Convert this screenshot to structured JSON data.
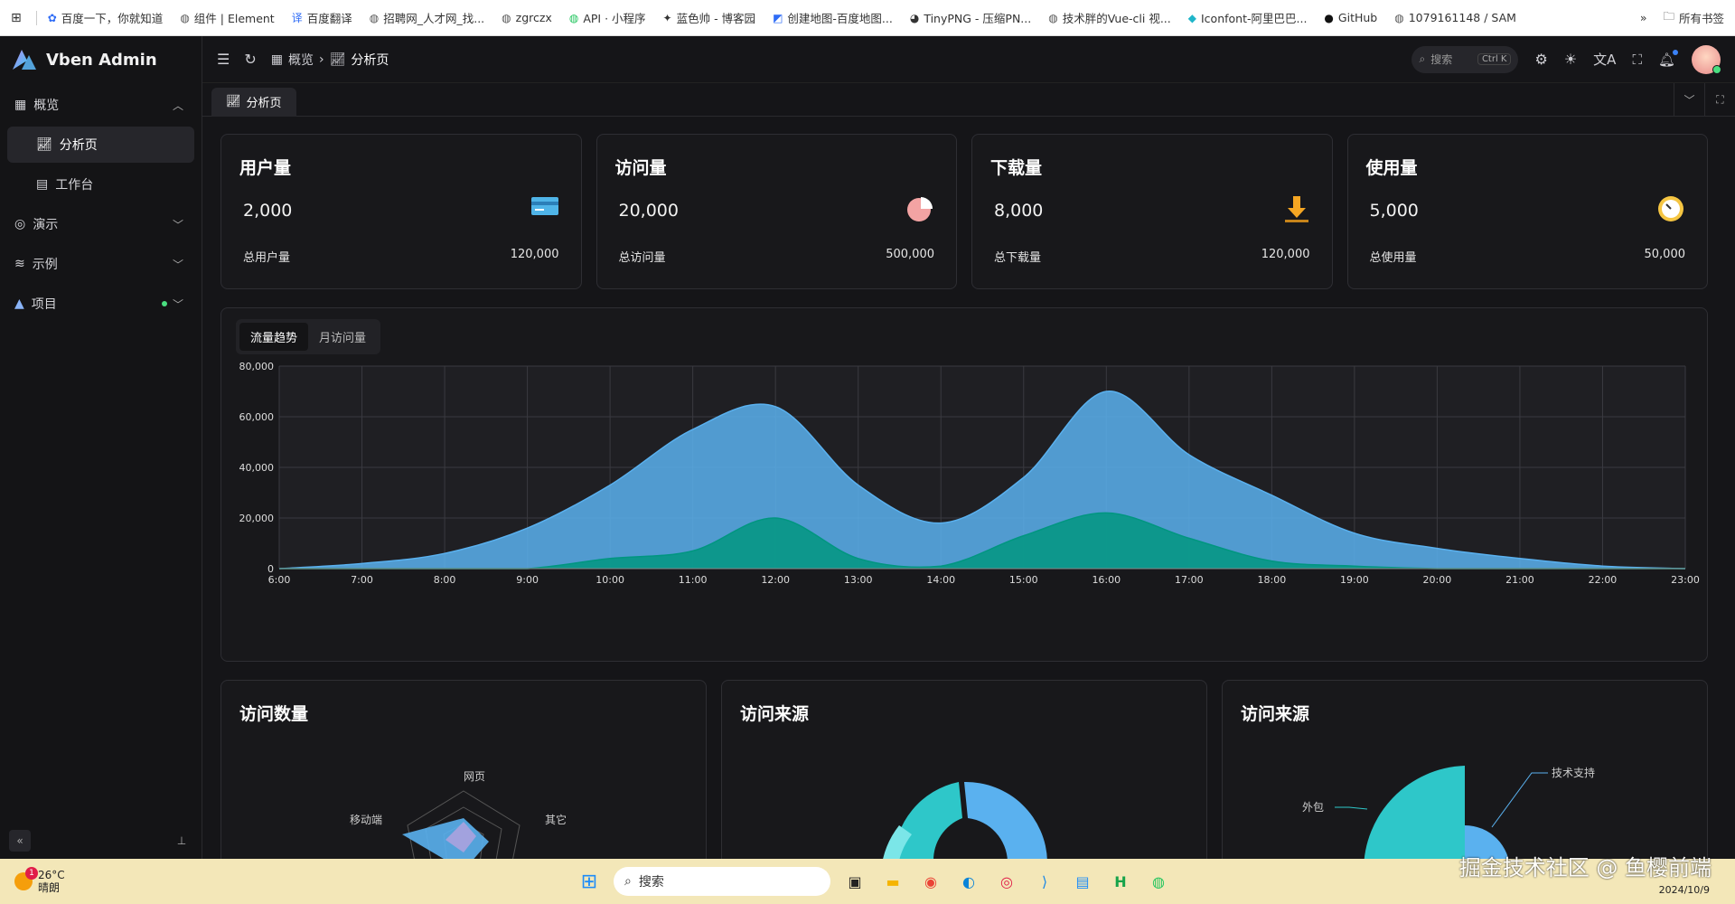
{
  "bookmarks": {
    "items": [
      {
        "label": "百度一下，你就知道",
        "icon": "paw-icon",
        "color": "#2f6cf6"
      },
      {
        "label": "组件 | Element",
        "icon": "globe-icon",
        "color": "#555"
      },
      {
        "label": "百度翻译",
        "icon": "translate-icon",
        "color": "#2f6cf6"
      },
      {
        "label": "招聘网_人才网_找...",
        "icon": "globe-icon",
        "color": "#555"
      },
      {
        "label": "zgrczx",
        "icon": "globe-icon",
        "color": "#555"
      },
      {
        "label": "API · 小程序",
        "icon": "wechat-icon",
        "color": "#22c55e"
      },
      {
        "label": "蓝色帅 - 博客园",
        "icon": "bird-icon",
        "color": "#333"
      },
      {
        "label": "创建地图-百度地图...",
        "icon": "map-icon",
        "color": "#2f6cf6"
      },
      {
        "label": "TinyPNG - 压缩PN...",
        "icon": "panda-icon",
        "color": "#333"
      },
      {
        "label": "技术胖的Vue-cli 视...",
        "icon": "globe-icon",
        "color": "#555"
      },
      {
        "label": "Iconfont-阿里巴巴...",
        "icon": "iconfont-icon",
        "color": "#1fb5c9"
      },
      {
        "label": "GitHub",
        "icon": "github-icon",
        "color": "#111"
      },
      {
        "label": "1079161148 / SAM",
        "icon": "globe-icon",
        "color": "#555"
      }
    ],
    "more": "»",
    "all_label": "所有书签"
  },
  "brand": {
    "name": "Vben Admin"
  },
  "sidebar": {
    "items": [
      {
        "label": "概览",
        "icon": "grid-icon",
        "chevron": "⌃"
      },
      {
        "label": "分析页",
        "icon": "chart-icon"
      },
      {
        "label": "工作台",
        "icon": "workbench-icon"
      },
      {
        "label": "演示",
        "icon": "demo-icon",
        "chevron": "⌄"
      },
      {
        "label": "示例",
        "icon": "layers-icon",
        "chevron": "⌄"
      },
      {
        "label": "项目",
        "icon": "vben-icon",
        "chevron": "⌄"
      }
    ]
  },
  "header": {
    "breadcrumb": [
      "概览",
      "分析页"
    ],
    "search_placeholder": "搜索",
    "search_shortcut": "Ctrl K"
  },
  "tabs": {
    "active": "分析页"
  },
  "stats": [
    {
      "title": "用户量",
      "value": "2,000",
      "foot_label": "总用户量",
      "foot_value": "120,000",
      "icon": "card-icon"
    },
    {
      "title": "访问量",
      "value": "20,000",
      "foot_label": "总访问量",
      "foot_value": "500,000",
      "icon": "pie-icon"
    },
    {
      "title": "下载量",
      "value": "8,000",
      "foot_label": "总下载量",
      "foot_value": "120,000",
      "icon": "download-icon"
    },
    {
      "title": "使用量",
      "value": "5,000",
      "foot_label": "总使用量",
      "foot_value": "50,000",
      "icon": "gauge-icon"
    }
  ],
  "trend": {
    "tabs": [
      "流量趋势",
      "月访问量"
    ]
  },
  "chart_data": [
    {
      "type": "area",
      "x": [
        "6:00",
        "7:00",
        "8:00",
        "9:00",
        "10:00",
        "11:00",
        "12:00",
        "13:00",
        "14:00",
        "15:00",
        "16:00",
        "17:00",
        "18:00",
        "19:00",
        "20:00",
        "21:00",
        "22:00",
        "23:00"
      ],
      "ylim": [
        0,
        80000
      ],
      "yticks": [
        0,
        20000,
        40000,
        60000,
        80000
      ],
      "ytick_labels": [
        "0",
        "20,000",
        "40,000",
        "60,000",
        "80,000"
      ],
      "series": [
        {
          "values": [
            0,
            2000,
            6000,
            16000,
            33000,
            55000,
            64000,
            33000,
            18000,
            36000,
            70000,
            45000,
            29000,
            14000,
            8000,
            4000,
            1000,
            0
          ],
          "color": "#5ab1ef"
        },
        {
          "values": [
            0,
            0,
            0,
            0,
            4000,
            7000,
            20000,
            4000,
            1000,
            13000,
            22000,
            12000,
            3000,
            1000,
            0,
            0,
            0,
            0
          ],
          "color": "#019680"
        }
      ],
      "grid": true
    }
  ],
  "bottom": [
    {
      "title": "访问数量",
      "labels": [
        "网页",
        "移动端",
        "其它"
      ]
    },
    {
      "title": "访问来源"
    },
    {
      "title": "访问来源",
      "labels": [
        "技术支持",
        "外包"
      ]
    }
  ],
  "taskbar": {
    "weather_temp": "26°C",
    "weather_text": "晴朗",
    "weather_badge": "1",
    "search": "搜索",
    "date": "2024/10/9"
  },
  "watermark": "掘金技术社区 @ 鱼樱前端"
}
